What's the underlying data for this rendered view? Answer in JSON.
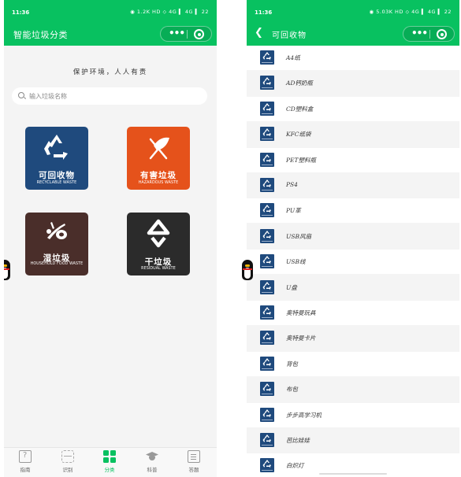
{
  "left_screen": {
    "status": {
      "time": "11:36",
      "icons": "◉ 1.2K HD ⬦ 4G ▍ 4G ▍ 22"
    },
    "nav_title": "智能垃圾分类",
    "slogan": "保护环境，人人有责",
    "search_placeholder": "输入垃圾名称",
    "categories": [
      {
        "cn": "可回收物",
        "en": "RECYCLABLE WASTE",
        "color": "#1f4a7d"
      },
      {
        "cn": "有害垃圾",
        "en": "HAZARDOUS WASTE",
        "color": "#e5521b"
      },
      {
        "cn": "湿垃圾",
        "en": "HOUSEHOLD FOOD WASTE",
        "color": "#4a2e2a"
      },
      {
        "cn": "干垃圾",
        "en": "RESIDUAL WASTE",
        "color": "#2b2b2b"
      }
    ],
    "tabs": [
      {
        "label": "指南",
        "icon": "guide-icon"
      },
      {
        "label": "识别",
        "icon": "scan-icon"
      },
      {
        "label": "分类",
        "icon": "grid-icon"
      },
      {
        "label": "科普",
        "icon": "graduation-cap-icon"
      },
      {
        "label": "答题",
        "icon": "quiz-icon"
      }
    ],
    "active_tab": "分类"
  },
  "right_screen": {
    "status": {
      "time": "11:36",
      "icons": "◉ 5.03K HD ⬦ 4G ▍ 4G ▍ 22"
    },
    "nav_title": "可回收物",
    "items": [
      "A4纸",
      "AD钙奶瓶",
      "CD塑料盒",
      "KFC纸袋",
      "PET塑料瓶",
      "PS4",
      "PU革",
      "USB风扇",
      "USB线",
      "U盘",
      "奥特曼玩具",
      "奥特曼卡片",
      "背包",
      "布包",
      "步步高学习机",
      "芭比娃娃",
      "白炽灯"
    ]
  },
  "colors": {
    "accent": "#08c160",
    "recyclable": "#1f4a7d",
    "hazardous": "#e5521b",
    "food": "#4a2e2a",
    "residual": "#2b2b2b"
  }
}
